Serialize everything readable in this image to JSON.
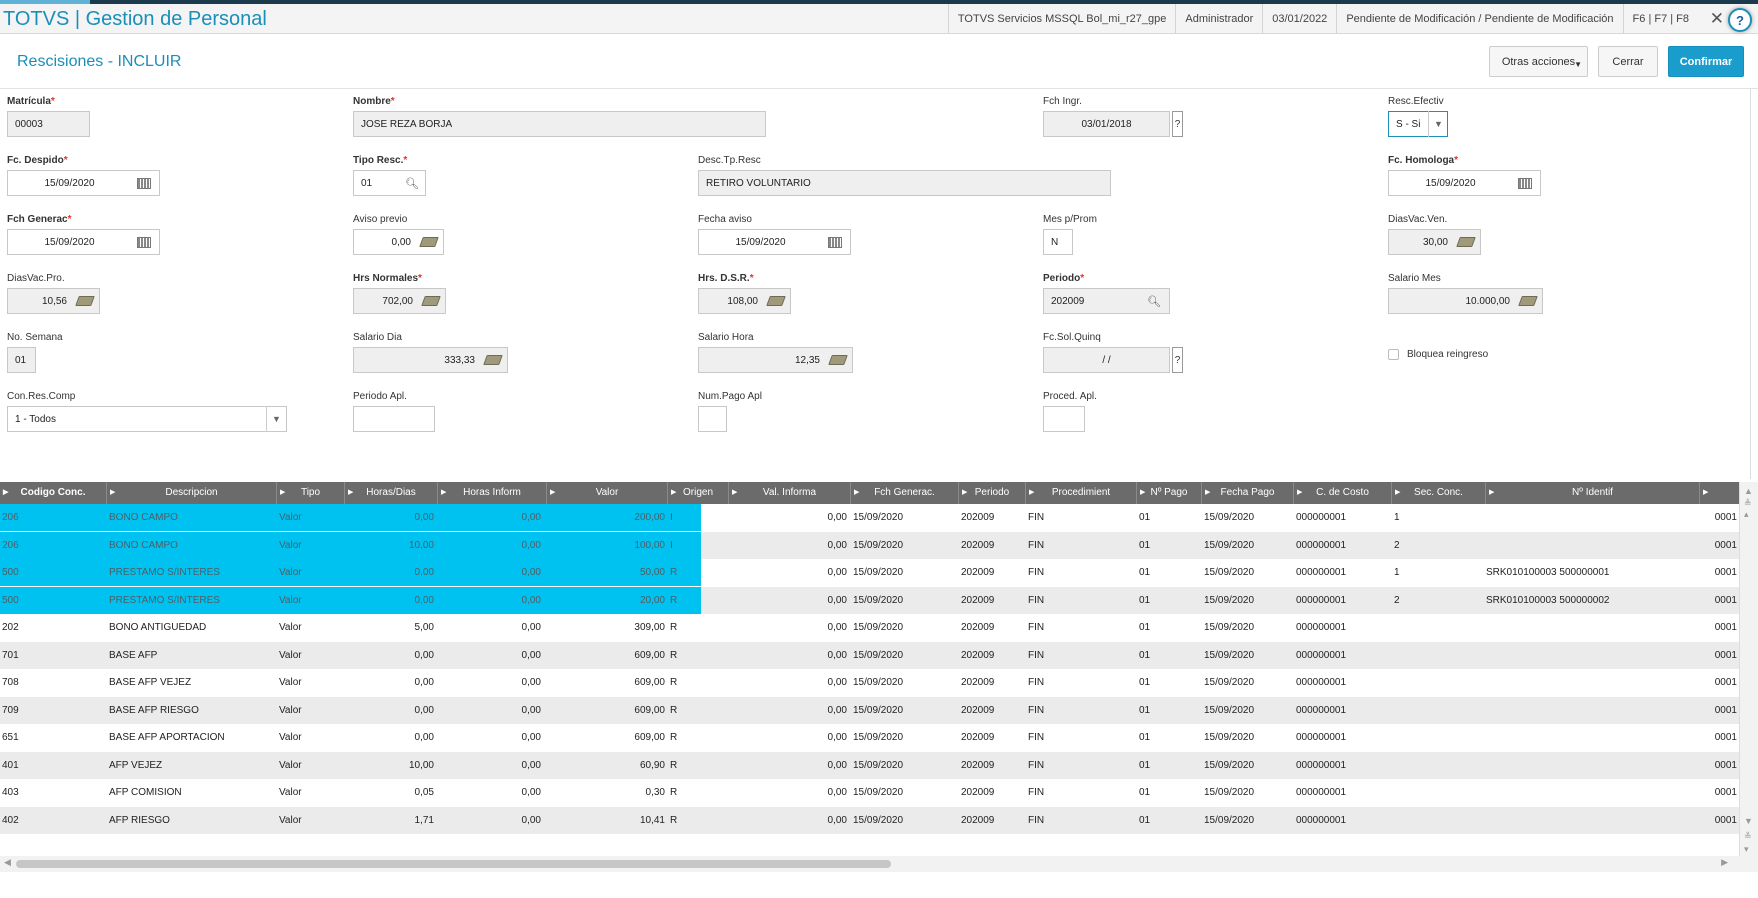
{
  "header": {
    "app_title": "TOTVS | Gestion de Personal",
    "server": "TOTVS Servicios MSSQL Bol_mi_r27_gpe",
    "user": "Administrador",
    "date": "03/01/2022",
    "status": "Pendiente de Modificación / Pendiente de Modificación",
    "shortcuts": "F6 | F7 | F8",
    "close_glyph": "✕",
    "help_glyph": "?"
  },
  "toolbar": {
    "page_title": "Rescisiones - INCLUIR",
    "otras_acciones": "Otras acciones",
    "cerrar": "Cerrar",
    "confirmar": "Confirmar"
  },
  "form": {
    "matricula": {
      "label": "Matrícula",
      "value": "00003"
    },
    "nombre": {
      "label": "Nombre",
      "value": "JOSE  REZA BORJA"
    },
    "fch_ingr": {
      "label": "Fch Ingr.",
      "value": "03/01/2018"
    },
    "resc_efectiv": {
      "label": "Resc.Efectiv",
      "value": "S - Si"
    },
    "fc_despido": {
      "label": "Fc. Despido",
      "value": "15/09/2020"
    },
    "tipo_resc": {
      "label": "Tipo Resc.",
      "value": "01"
    },
    "desc_tp_resc": {
      "label": "Desc.Tp.Resc",
      "value": "RETIRO VOLUNTARIO"
    },
    "fc_homologa": {
      "label": "Fc. Homologa",
      "value": "15/09/2020"
    },
    "fch_generac": {
      "label": "Fch Generac",
      "value": "15/09/2020"
    },
    "aviso_previo": {
      "label": "Aviso previo",
      "value": "0,00"
    },
    "fecha_aviso": {
      "label": "Fecha aviso",
      "value": "15/09/2020"
    },
    "mes_prom": {
      "label": "Mes p/Prom",
      "value": "N"
    },
    "dias_vac_ven": {
      "label": "DiasVac.Ven.",
      "value": "30,00"
    },
    "dias_vac_pro": {
      "label": "DiasVac.Pro.",
      "value": "10,56"
    },
    "hrs_normales": {
      "label": "Hrs Normales",
      "value": "702,00"
    },
    "hrs_dsr": {
      "label": "Hrs. D.S.R.",
      "value": "108,00"
    },
    "periodo": {
      "label": "Periodo",
      "value": "202009"
    },
    "salario_mes": {
      "label": "Salario Mes",
      "value": "10.000,00"
    },
    "no_semana": {
      "label": "No. Semana",
      "value": "01"
    },
    "salario_dia": {
      "label": "Salario Dia",
      "value": "333,33"
    },
    "salario_hora": {
      "label": "Salario Hora",
      "value": "12,35"
    },
    "fc_sol_quinq": {
      "label": "Fc.Sol.Quinq",
      "value": " / /"
    },
    "bloquea_reingreso": {
      "label": "Bloquea reingreso"
    },
    "con_res_comp": {
      "label": "Con.Res.Comp",
      "value": "1 - Todos"
    },
    "periodo_apl": {
      "label": "Periodo Apl.",
      "value": ""
    },
    "num_pago_apl": {
      "label": "Num.Pago Apl",
      "value": ""
    },
    "proced_apl": {
      "label": "Proced. Apl.",
      "value": ""
    }
  },
  "grid": {
    "headers": [
      "Codigo Conc.",
      "Descripcion",
      "Tipo",
      "Horas/Dias",
      "Horas Inform",
      "Valor",
      "Origen",
      "Val. Informa",
      "Fch Generac.",
      "Periodo",
      "Procedimient",
      "Nº Pago",
      "Fecha Pago",
      "C. de Costo",
      "Sec. Conc.",
      "Nº Identif"
    ],
    "rows": [
      {
        "codigo": "206",
        "desc": "BONO CAMPO",
        "tipo": "Valor",
        "horas": "0,00",
        "hinf": "0,00",
        "valor": "200,00",
        "origen": "I",
        "valinf": "0,00",
        "fch": "15/09/2020",
        "periodo": "202009",
        "proc": "FIN",
        "npago": "01",
        "fpago": "15/09/2020",
        "costo": "000000001",
        "sec": "1",
        "ident": "",
        "fil": "0001"
      },
      {
        "codigo": "206",
        "desc": "BONO CAMPO",
        "tipo": "Valor",
        "horas": "10,00",
        "hinf": "0,00",
        "valor": "100,00",
        "origen": "I",
        "valinf": "0,00",
        "fch": "15/09/2020",
        "periodo": "202009",
        "proc": "FIN",
        "npago": "01",
        "fpago": "15/09/2020",
        "costo": "000000001",
        "sec": "2",
        "ident": "",
        "fil": "0001"
      },
      {
        "codigo": "500",
        "desc": "PRESTAMO S/INTERES",
        "tipo": "Valor",
        "horas": "0,00",
        "hinf": "0,00",
        "valor": "50,00",
        "origen": "R",
        "valinf": "0,00",
        "fch": "15/09/2020",
        "periodo": "202009",
        "proc": "FIN",
        "npago": "01",
        "fpago": "15/09/2020",
        "costo": "000000001",
        "sec": "1",
        "ident": "SRK010100003 500000001",
        "fil": "0001"
      },
      {
        "codigo": "500",
        "desc": "PRESTAMO S/INTERES",
        "tipo": "Valor",
        "horas": "0,00",
        "hinf": "0,00",
        "valor": "20,00",
        "origen": "R",
        "valinf": "0,00",
        "fch": "15/09/2020",
        "periodo": "202009",
        "proc": "FIN",
        "npago": "01",
        "fpago": "15/09/2020",
        "costo": "000000001",
        "sec": "2",
        "ident": "SRK010100003 500000002",
        "fil": "0001"
      },
      {
        "codigo": "202",
        "desc": "BONO ANTIGUEDAD",
        "tipo": "Valor",
        "horas": "5,00",
        "hinf": "0,00",
        "valor": "309,00",
        "origen": "R",
        "valinf": "0,00",
        "fch": "15/09/2020",
        "periodo": "202009",
        "proc": "FIN",
        "npago": "01",
        "fpago": "15/09/2020",
        "costo": "000000001",
        "sec": "",
        "ident": "",
        "fil": "0001"
      },
      {
        "codigo": "701",
        "desc": "BASE AFP",
        "tipo": "Valor",
        "horas": "0,00",
        "hinf": "0,00",
        "valor": "609,00",
        "origen": "R",
        "valinf": "0,00",
        "fch": "15/09/2020",
        "periodo": "202009",
        "proc": "FIN",
        "npago": "01",
        "fpago": "15/09/2020",
        "costo": "000000001",
        "sec": "",
        "ident": "",
        "fil": "0001"
      },
      {
        "codigo": "708",
        "desc": "BASE AFP VEJEZ",
        "tipo": "Valor",
        "horas": "0,00",
        "hinf": "0,00",
        "valor": "609,00",
        "origen": "R",
        "valinf": "0,00",
        "fch": "15/09/2020",
        "periodo": "202009",
        "proc": "FIN",
        "npago": "01",
        "fpago": "15/09/2020",
        "costo": "000000001",
        "sec": "",
        "ident": "",
        "fil": "0001"
      },
      {
        "codigo": "709",
        "desc": "BASE AFP RIESGO",
        "tipo": "Valor",
        "horas": "0,00",
        "hinf": "0,00",
        "valor": "609,00",
        "origen": "R",
        "valinf": "0,00",
        "fch": "15/09/2020",
        "periodo": "202009",
        "proc": "FIN",
        "npago": "01",
        "fpago": "15/09/2020",
        "costo": "000000001",
        "sec": "",
        "ident": "",
        "fil": "0001"
      },
      {
        "codigo": "651",
        "desc": "BASE AFP APORTACION",
        "tipo": "Valor",
        "horas": "0,00",
        "hinf": "0,00",
        "valor": "609,00",
        "origen": "R",
        "valinf": "0,00",
        "fch": "15/09/2020",
        "periodo": "202009",
        "proc": "FIN",
        "npago": "01",
        "fpago": "15/09/2020",
        "costo": "000000001",
        "sec": "",
        "ident": "",
        "fil": "0001"
      },
      {
        "codigo": "401",
        "desc": "AFP VEJEZ",
        "tipo": "Valor",
        "horas": "10,00",
        "hinf": "0,00",
        "valor": "60,90",
        "origen": "R",
        "valinf": "0,00",
        "fch": "15/09/2020",
        "periodo": "202009",
        "proc": "FIN",
        "npago": "01",
        "fpago": "15/09/2020",
        "costo": "000000001",
        "sec": "",
        "ident": "",
        "fil": "0001"
      },
      {
        "codigo": "403",
        "desc": "AFP COMISION",
        "tipo": "Valor",
        "horas": "0,05",
        "hinf": "0,00",
        "valor": "0,30",
        "origen": "R",
        "valinf": "0,00",
        "fch": "15/09/2020",
        "periodo": "202009",
        "proc": "FIN",
        "npago": "01",
        "fpago": "15/09/2020",
        "costo": "000000001",
        "sec": "",
        "ident": "",
        "fil": "0001"
      },
      {
        "codigo": "402",
        "desc": "AFP RIESGO",
        "tipo": "Valor",
        "horas": "1,71",
        "hinf": "0,00",
        "valor": "10,41",
        "origen": "R",
        "valinf": "0,00",
        "fch": "15/09/2020",
        "periodo": "202009",
        "proc": "FIN",
        "npago": "01",
        "fpago": "15/09/2020",
        "costo": "000000001",
        "sec": "",
        "ident": "",
        "fil": "0001"
      }
    ],
    "highlighted_rows": 4,
    "highlight_color": "#00c2f0"
  },
  "colors": {
    "accent": "#1a8fb9",
    "confirm": "#1a9ccc",
    "required": "#e23030"
  }
}
